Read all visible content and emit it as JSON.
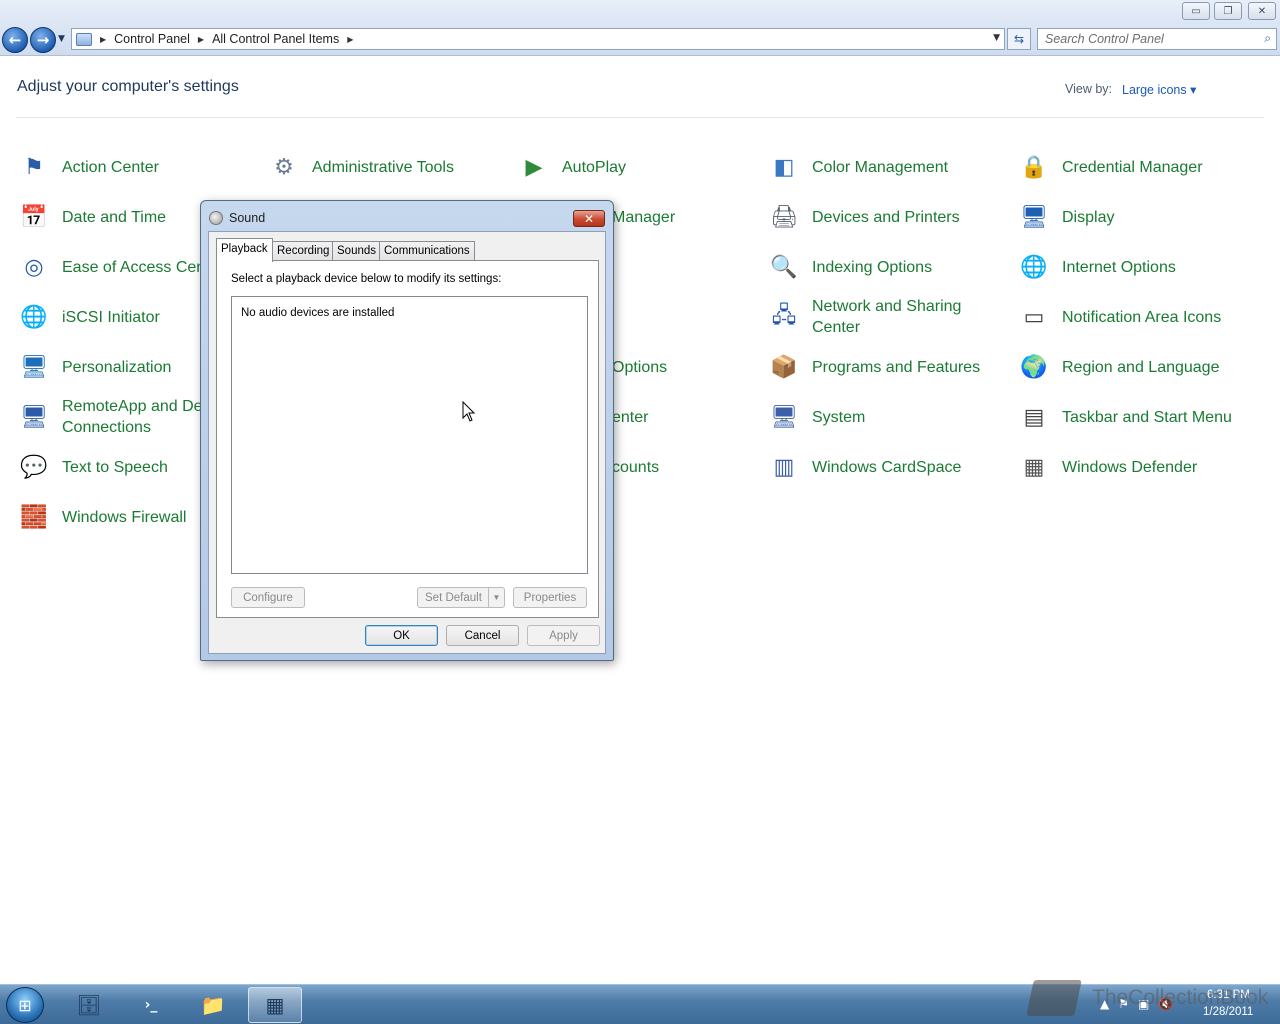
{
  "window": {
    "minimize_glyph": "▭",
    "maximize_glyph": "❐",
    "close_glyph": "✕"
  },
  "nav": {
    "back_glyph": "←",
    "forward_glyph": "→",
    "history_glyph": "▼",
    "breadcrumbs": [
      "Control Panel",
      "All Control Panel Items"
    ],
    "separator_glyph": "▶",
    "dropdown_glyph": "▼",
    "refresh_glyph": "⇆",
    "search_placeholder": "Search Control Panel",
    "search_glyph": "⌕"
  },
  "page": {
    "heading": "Adjust your computer's settings",
    "view_by_label": "View by:",
    "view_by_value": "Large icons ▾"
  },
  "items": [
    {
      "label": "Action Center",
      "icon": "action-center-flag-icon",
      "glyph": "⚑"
    },
    {
      "label": "Administrative Tools",
      "icon": "administrative-tools-icon",
      "glyph": "⚙"
    },
    {
      "label": "AutoPlay",
      "icon": "autoplay-icon",
      "glyph": "▶"
    },
    {
      "label": "Color Management",
      "icon": "color-management-icon",
      "glyph": "◧"
    },
    {
      "label": "Credential Manager",
      "icon": "credential-manager-icon",
      "glyph": "🔒"
    },
    {
      "label": "Date and Time",
      "icon": "date-and-time-icon",
      "glyph": "📅"
    },
    {
      "label": "Manager",
      "icon": "device-manager-icon",
      "glyph": ""
    },
    {
      "label": "Devices and Printers",
      "icon": "devices-and-printers-icon",
      "glyph": "🖨"
    },
    {
      "label": "Display",
      "icon": "display-icon",
      "glyph": "🖥"
    },
    {
      "label": "Ease of Access Cente",
      "icon": "ease-of-access-icon",
      "glyph": "◎"
    },
    {
      "label": "Indexing Options",
      "icon": "indexing-options-icon",
      "glyph": "🔍"
    },
    {
      "label": "Internet Options",
      "icon": "internet-options-icon",
      "glyph": "🌐"
    },
    {
      "label": "iSCSI Initiator",
      "icon": "iscsi-initiator-icon",
      "glyph": "🌐"
    },
    {
      "label": "Network and Sharing Center",
      "icon": "network-and-sharing-icon",
      "glyph": "🖧"
    },
    {
      "label": "Notification Area Icons",
      "icon": "notification-area-icon",
      "glyph": "▭"
    },
    {
      "label": "Personalization",
      "icon": "personalization-icon",
      "glyph": "🖥"
    },
    {
      "label": "Options",
      "icon": "options-icon",
      "glyph": ""
    },
    {
      "label": "Programs and Features",
      "icon": "programs-and-features-icon",
      "glyph": "📦"
    },
    {
      "label": "Region and Language",
      "icon": "region-and-language-icon",
      "glyph": "🌍"
    },
    {
      "label": "RemoteApp and Des Connections",
      "icon": "remoteapp-icon",
      "glyph": "🖥"
    },
    {
      "label": "enter",
      "icon": "center-icon",
      "glyph": ""
    },
    {
      "label": "System",
      "icon": "system-icon",
      "glyph": "🖥"
    },
    {
      "label": "Taskbar and Start Menu",
      "icon": "taskbar-and-start-menu-icon",
      "glyph": "▤"
    },
    {
      "label": "Text to Speech",
      "icon": "text-to-speech-icon",
      "glyph": "💬"
    },
    {
      "label": "counts",
      "icon": "accounts-icon",
      "glyph": ""
    },
    {
      "label": "Windows CardSpace",
      "icon": "windows-cardspace-icon",
      "glyph": "▥"
    },
    {
      "label": "Windows Defender",
      "icon": "windows-defender-icon",
      "glyph": "▦"
    },
    {
      "label": "Windows Firewall",
      "icon": "windows-firewall-icon",
      "glyph": "🧱"
    }
  ],
  "dialog": {
    "title": "Sound",
    "close_glyph": "✕",
    "tabs": [
      "Playback",
      "Recording",
      "Sounds",
      "Communications"
    ],
    "instruction": "Select a playback device below to modify its settings:",
    "empty_message": "No audio devices are installed",
    "configure": "Configure",
    "set_default": "Set Default",
    "split_glyph": "▼",
    "properties": "Properties",
    "ok": "OK",
    "cancel": "Cancel",
    "apply": "Apply"
  },
  "taskbar": {
    "start_glyph": "⊞",
    "buttons": [
      {
        "name": "server-manager-icon",
        "glyph": "🗄"
      },
      {
        "name": "powershell-icon",
        "glyph": "›_"
      },
      {
        "name": "explorer-folder-icon",
        "glyph": "📁"
      },
      {
        "name": "control-panel-icon",
        "glyph": "▦"
      }
    ],
    "tray_glyphs": [
      "▲",
      "⚑",
      "▣",
      "🔇"
    ],
    "time": "6:31 PM",
    "date": "1/28/2011"
  },
  "watermark": {
    "text": "TheCollectionBook"
  },
  "colors": {
    "link_green": "#1b7a33",
    "heading_blue": "#1e395b",
    "dialog_frame": "#b4c9e5",
    "close_red": "#c94a33"
  }
}
